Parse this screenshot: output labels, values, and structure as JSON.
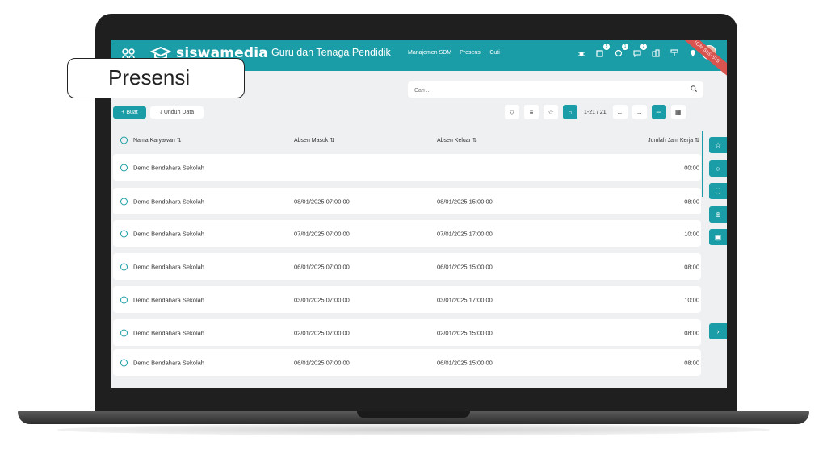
{
  "callout": {
    "label": "Presensi"
  },
  "topbar": {
    "logo_text": "siswamedia",
    "app_title": "Guru dan Tenaga Pendidik",
    "nav": [
      "Manajemen SDM",
      "Presensi",
      "Cuti"
    ],
    "badges": {
      "notes": "5",
      "activity": "1",
      "chat": "2"
    },
    "ribbon_text": "ION SIS-SIS"
  },
  "search": {
    "placeholder": "Cari ..."
  },
  "actions": {
    "create_label": "+ Buat",
    "download_label": "Unduh Data"
  },
  "pager": {
    "text": "1-21 / 21"
  },
  "table": {
    "headers": {
      "name": "Nama Karyawan ⇅",
      "in": "Absen Masuk ⇅",
      "out": "Absen Keluar ⇅",
      "hours": "Jumlah Jam Kerja ⇅"
    },
    "rows": [
      {
        "name": "Demo Bendahara Sekolah",
        "in": "",
        "out": "",
        "hours": "00:00"
      },
      {
        "name": "Demo Bendahara Sekolah",
        "in": "08/01/2025 07:00:00",
        "out": "08/01/2025 15:00:00",
        "hours": "08:00"
      },
      {
        "name": "Demo Bendahara Sekolah",
        "in": "07/01/2025 07:00:00",
        "out": "07/01/2025 17:00:00",
        "hours": "10:00"
      },
      {
        "name": "Demo Bendahara Sekolah",
        "in": "06/01/2025 07:00:00",
        "out": "06/01/2025 15:00:00",
        "hours": "08:00"
      },
      {
        "name": "Demo Bendahara Sekolah",
        "in": "03/01/2025 07:00:00",
        "out": "03/01/2025 17:00:00",
        "hours": "10:00"
      },
      {
        "name": "Demo Bendahara Sekolah",
        "in": "02/01/2025 07:00:00",
        "out": "02/01/2025 15:00:00",
        "hours": "08:00"
      },
      {
        "name": "Demo Bendahara Sekolah",
        "in": "06/01/2025 07:00:00",
        "out": "06/01/2025 15:00:00",
        "hours": "08:00"
      }
    ]
  },
  "colors": {
    "accent": "#1a9da6",
    "ribbon": "#d9534f"
  }
}
